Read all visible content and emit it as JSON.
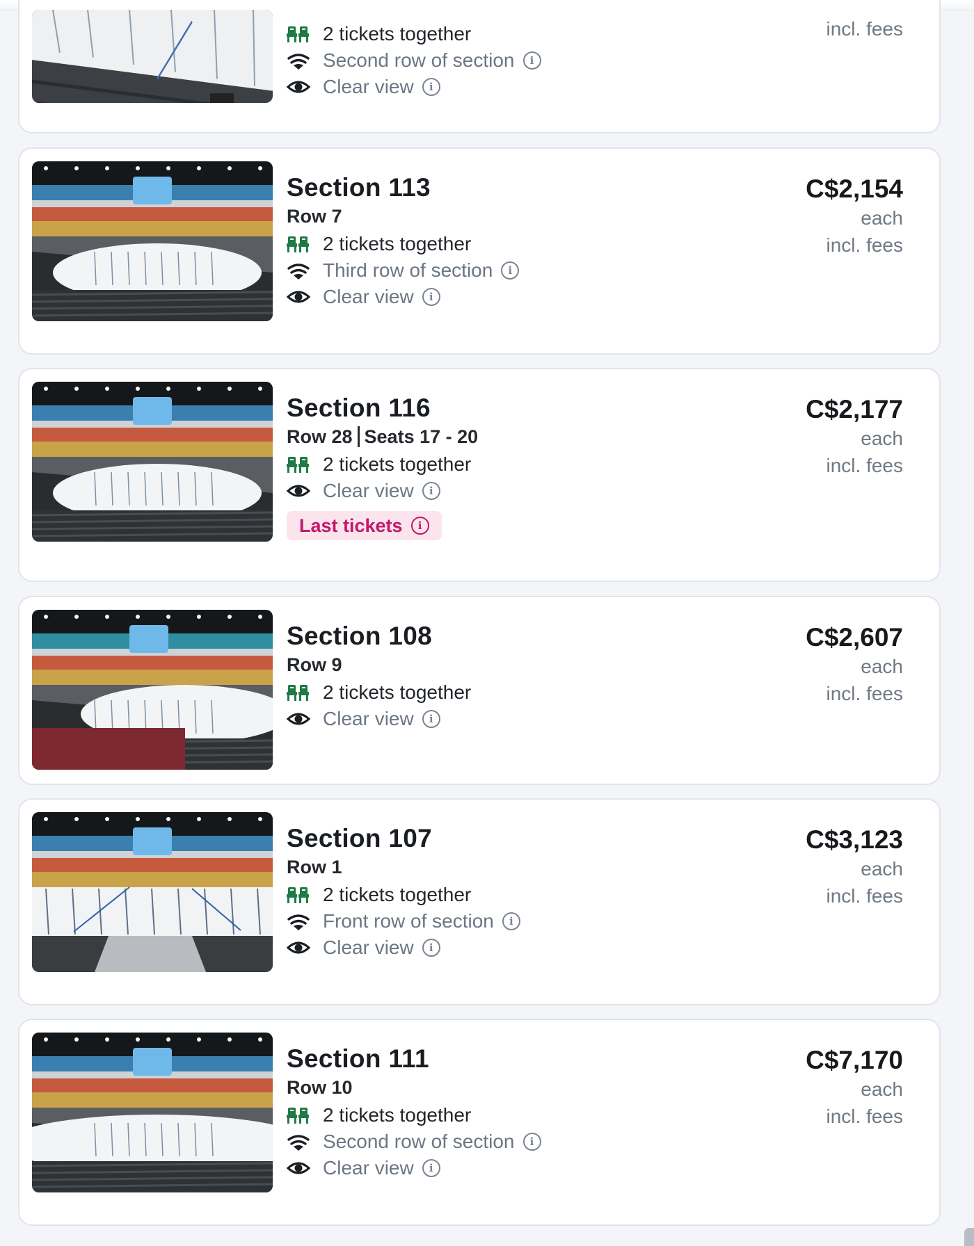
{
  "info_glyph": "i",
  "listings": [
    {
      "section": "",
      "row": "",
      "seats": "",
      "features": [
        {
          "icon": "seats-icon",
          "text": "2 tickets together",
          "style": "dark",
          "info": false
        },
        {
          "icon": "stadium-row-icon",
          "text": "Second row of section",
          "style": "muted",
          "info": true
        },
        {
          "icon": "eye-icon",
          "text": "Clear view",
          "style": "muted",
          "info": true
        }
      ],
      "price": "",
      "each": "",
      "fees": "incl. fees",
      "badge": ""
    },
    {
      "section": "Section 113",
      "row": "Row 7",
      "seats": "",
      "features": [
        {
          "icon": "seats-icon",
          "text": "2 tickets together",
          "style": "dark",
          "info": false
        },
        {
          "icon": "stadium-row-icon",
          "text": "Third row of section",
          "style": "muted",
          "info": true
        },
        {
          "icon": "eye-icon",
          "text": "Clear view",
          "style": "muted",
          "info": true
        }
      ],
      "price": "C$2,154",
      "each": "each",
      "fees": "incl. fees",
      "badge": ""
    },
    {
      "section": "Section 116",
      "row": "Row 28",
      "seats": "Seats 17 - 20",
      "features": [
        {
          "icon": "seats-icon",
          "text": "2 tickets together",
          "style": "dark",
          "info": false
        },
        {
          "icon": "eye-icon",
          "text": "Clear view",
          "style": "muted",
          "info": true
        }
      ],
      "price": "C$2,177",
      "each": "each",
      "fees": "incl. fees",
      "badge": "Last tickets"
    },
    {
      "section": "Section 108",
      "row": "Row 9",
      "seats": "",
      "features": [
        {
          "icon": "seats-icon",
          "text": "2 tickets together",
          "style": "dark",
          "info": false
        },
        {
          "icon": "eye-icon",
          "text": "Clear view",
          "style": "muted",
          "info": true
        }
      ],
      "price": "C$2,607",
      "each": "each",
      "fees": "incl. fees",
      "badge": ""
    },
    {
      "section": "Section 107",
      "row": "Row 1",
      "seats": "",
      "features": [
        {
          "icon": "seats-icon",
          "text": "2 tickets together",
          "style": "dark",
          "info": false
        },
        {
          "icon": "stadium-row-icon",
          "text": "Front row of section",
          "style": "muted",
          "info": true
        },
        {
          "icon": "eye-icon",
          "text": "Clear view",
          "style": "muted",
          "info": true
        }
      ],
      "price": "C$3,123",
      "each": "each",
      "fees": "incl. fees",
      "badge": ""
    },
    {
      "section": "Section 111",
      "row": "Row 10",
      "seats": "",
      "features": [
        {
          "icon": "seats-icon",
          "text": "2 tickets together",
          "style": "dark",
          "info": false
        },
        {
          "icon": "stadium-row-icon",
          "text": "Second row of section",
          "style": "muted",
          "info": true
        },
        {
          "icon": "eye-icon",
          "text": "Clear view",
          "style": "muted",
          "info": true
        }
      ],
      "price": "C$7,170",
      "each": "each",
      "fees": "incl. fees",
      "badge": ""
    }
  ],
  "colors": {
    "seat_icon": "#1f7a46",
    "badge_bg": "#fce4ec",
    "badge_text": "#c2186b",
    "muted_text": "#6b7684"
  }
}
